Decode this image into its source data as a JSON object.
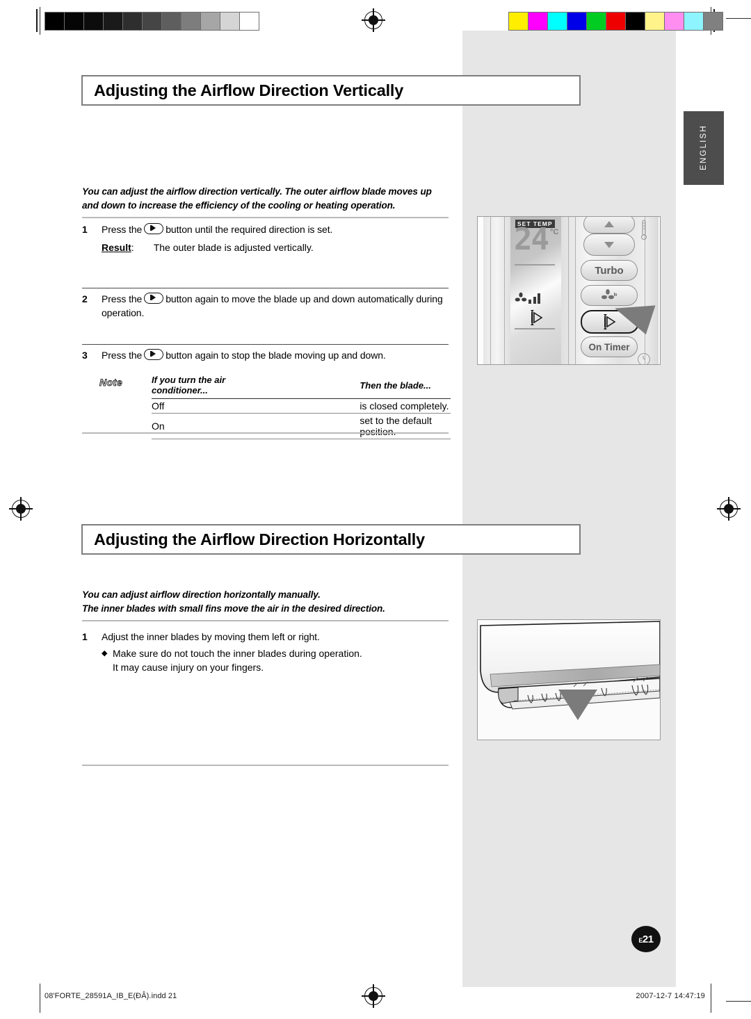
{
  "language_tab": "ENGLISH",
  "page_badge": {
    "prefix": "E",
    "number": "21"
  },
  "footer": {
    "file": "08'FORTE_28591A_IB_E(ÐÂ).indd   21",
    "date": "2007-12-7   14:47:19"
  },
  "calibration": {
    "gray_swatches": [
      "#000000",
      "#050505",
      "#0c0c0c",
      "#1a1a1a",
      "#2e2e2e",
      "#454545",
      "#5e5e5e",
      "#7d7d7d",
      "#a6a6a6",
      "#d5d5d5",
      "#ffffff"
    ],
    "color_swatches": [
      "#ffee00",
      "#ff00ff",
      "#00ffff",
      "#0000e8",
      "#00cc22",
      "#ee0000",
      "#000000",
      "#fff38a",
      "#ff8ef0",
      "#8ef4ff",
      "#808080"
    ]
  },
  "sections": [
    {
      "heading": "Adjusting the Airflow Direction Vertically",
      "intro": "You can adjust the airflow direction vertically. The outer airflow blade moves up and down to increase the efficiency of the cooling or heating operation.",
      "steps": [
        {
          "number": "1",
          "text_before": "Press the",
          "text_after": "button until the required direction is set.",
          "result_label": "Result",
          "result_colon": ":",
          "result_text": "The outer blade is adjusted vertically."
        },
        {
          "number": "2",
          "text_before": "Press the",
          "text_after": "button again to move the blade up and down automatically during operation."
        },
        {
          "number": "3",
          "text_before": "Press the",
          "text_after": "button again to stop the blade moving up and down."
        }
      ],
      "note": {
        "label": "Note",
        "headers": [
          "If you turn the air conditioner...",
          "Then the blade..."
        ],
        "rows": [
          [
            "Off",
            "is closed completely."
          ],
          [
            "On",
            "set to the default position."
          ]
        ]
      }
    },
    {
      "heading": "Adjusting the Airflow Direction Horizontally",
      "intro_line1": "You can adjust airflow direction horizontally manually.",
      "intro_line2": "The inner blades with small fins move the air in the desired direction.",
      "steps": [
        {
          "number": "1",
          "text": "Adjust the inner blades by moving them left or right."
        }
      ],
      "bullets": [
        {
          "marker": "◆",
          "line1": "Make sure do not touch the inner blades during operation.",
          "line2": "It may cause injury on your fingers."
        }
      ]
    }
  ],
  "remote_figure": {
    "lcd": {
      "set_temp_label": "SET  TEMP",
      "temperature": "24",
      "unit": "°C"
    },
    "buttons": {
      "up": "▲",
      "down": "▼",
      "turbo": "Turbo",
      "fan": "fan-glyph",
      "blade": "blade-glyph",
      "on_timer": "On Timer"
    }
  },
  "colors": {
    "panel_gray": "#e6e6e6",
    "tab_gray": "#4d4d4d",
    "heading_border": "#7d7d7d",
    "rule": "#b9b9b9",
    "arrow": "#7b7b7b"
  }
}
